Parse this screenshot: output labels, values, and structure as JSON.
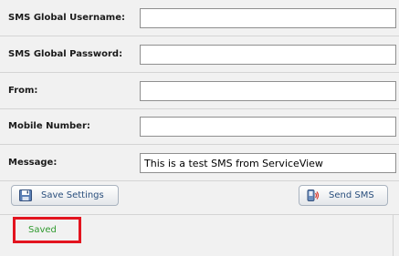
{
  "form": {
    "fields": [
      {
        "label": "SMS Global Username:",
        "value": ""
      },
      {
        "label": "SMS Global Password:",
        "value": ""
      },
      {
        "label": "From:",
        "value": ""
      },
      {
        "label": "Mobile Number:",
        "value": ""
      },
      {
        "label": "Message:",
        "value": "This is a test SMS from ServiceView"
      }
    ]
  },
  "actions": {
    "save_label": "Save Settings",
    "send_label": "Send SMS"
  },
  "status": {
    "message": "Saved",
    "color": "#2f9a2f",
    "highlight_color": "#e3141f"
  },
  "icons": {
    "save": "floppy-disk-icon",
    "send": "phone-send-icon"
  }
}
